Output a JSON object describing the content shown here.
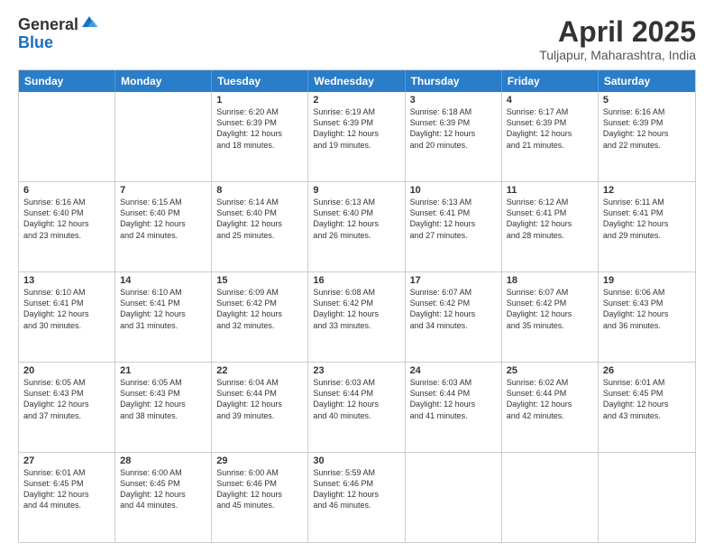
{
  "logo": {
    "general": "General",
    "blue": "Blue"
  },
  "header": {
    "title": "April 2025",
    "subtitle": "Tuljapur, Maharashtra, India"
  },
  "days": [
    "Sunday",
    "Monday",
    "Tuesday",
    "Wednesday",
    "Thursday",
    "Friday",
    "Saturday"
  ],
  "weeks": [
    [
      {
        "day": "",
        "lines": []
      },
      {
        "day": "",
        "lines": []
      },
      {
        "day": "1",
        "lines": [
          "Sunrise: 6:20 AM",
          "Sunset: 6:39 PM",
          "Daylight: 12 hours",
          "and 18 minutes."
        ]
      },
      {
        "day": "2",
        "lines": [
          "Sunrise: 6:19 AM",
          "Sunset: 6:39 PM",
          "Daylight: 12 hours",
          "and 19 minutes."
        ]
      },
      {
        "day": "3",
        "lines": [
          "Sunrise: 6:18 AM",
          "Sunset: 6:39 PM",
          "Daylight: 12 hours",
          "and 20 minutes."
        ]
      },
      {
        "day": "4",
        "lines": [
          "Sunrise: 6:17 AM",
          "Sunset: 6:39 PM",
          "Daylight: 12 hours",
          "and 21 minutes."
        ]
      },
      {
        "day": "5",
        "lines": [
          "Sunrise: 6:16 AM",
          "Sunset: 6:39 PM",
          "Daylight: 12 hours",
          "and 22 minutes."
        ]
      }
    ],
    [
      {
        "day": "6",
        "lines": [
          "Sunrise: 6:16 AM",
          "Sunset: 6:40 PM",
          "Daylight: 12 hours",
          "and 23 minutes."
        ]
      },
      {
        "day": "7",
        "lines": [
          "Sunrise: 6:15 AM",
          "Sunset: 6:40 PM",
          "Daylight: 12 hours",
          "and 24 minutes."
        ]
      },
      {
        "day": "8",
        "lines": [
          "Sunrise: 6:14 AM",
          "Sunset: 6:40 PM",
          "Daylight: 12 hours",
          "and 25 minutes."
        ]
      },
      {
        "day": "9",
        "lines": [
          "Sunrise: 6:13 AM",
          "Sunset: 6:40 PM",
          "Daylight: 12 hours",
          "and 26 minutes."
        ]
      },
      {
        "day": "10",
        "lines": [
          "Sunrise: 6:13 AM",
          "Sunset: 6:41 PM",
          "Daylight: 12 hours",
          "and 27 minutes."
        ]
      },
      {
        "day": "11",
        "lines": [
          "Sunrise: 6:12 AM",
          "Sunset: 6:41 PM",
          "Daylight: 12 hours",
          "and 28 minutes."
        ]
      },
      {
        "day": "12",
        "lines": [
          "Sunrise: 6:11 AM",
          "Sunset: 6:41 PM",
          "Daylight: 12 hours",
          "and 29 minutes."
        ]
      }
    ],
    [
      {
        "day": "13",
        "lines": [
          "Sunrise: 6:10 AM",
          "Sunset: 6:41 PM",
          "Daylight: 12 hours",
          "and 30 minutes."
        ]
      },
      {
        "day": "14",
        "lines": [
          "Sunrise: 6:10 AM",
          "Sunset: 6:41 PM",
          "Daylight: 12 hours",
          "and 31 minutes."
        ]
      },
      {
        "day": "15",
        "lines": [
          "Sunrise: 6:09 AM",
          "Sunset: 6:42 PM",
          "Daylight: 12 hours",
          "and 32 minutes."
        ]
      },
      {
        "day": "16",
        "lines": [
          "Sunrise: 6:08 AM",
          "Sunset: 6:42 PM",
          "Daylight: 12 hours",
          "and 33 minutes."
        ]
      },
      {
        "day": "17",
        "lines": [
          "Sunrise: 6:07 AM",
          "Sunset: 6:42 PM",
          "Daylight: 12 hours",
          "and 34 minutes."
        ]
      },
      {
        "day": "18",
        "lines": [
          "Sunrise: 6:07 AM",
          "Sunset: 6:42 PM",
          "Daylight: 12 hours",
          "and 35 minutes."
        ]
      },
      {
        "day": "19",
        "lines": [
          "Sunrise: 6:06 AM",
          "Sunset: 6:43 PM",
          "Daylight: 12 hours",
          "and 36 minutes."
        ]
      }
    ],
    [
      {
        "day": "20",
        "lines": [
          "Sunrise: 6:05 AM",
          "Sunset: 6:43 PM",
          "Daylight: 12 hours",
          "and 37 minutes."
        ]
      },
      {
        "day": "21",
        "lines": [
          "Sunrise: 6:05 AM",
          "Sunset: 6:43 PM",
          "Daylight: 12 hours",
          "and 38 minutes."
        ]
      },
      {
        "day": "22",
        "lines": [
          "Sunrise: 6:04 AM",
          "Sunset: 6:44 PM",
          "Daylight: 12 hours",
          "and 39 minutes."
        ]
      },
      {
        "day": "23",
        "lines": [
          "Sunrise: 6:03 AM",
          "Sunset: 6:44 PM",
          "Daylight: 12 hours",
          "and 40 minutes."
        ]
      },
      {
        "day": "24",
        "lines": [
          "Sunrise: 6:03 AM",
          "Sunset: 6:44 PM",
          "Daylight: 12 hours",
          "and 41 minutes."
        ]
      },
      {
        "day": "25",
        "lines": [
          "Sunrise: 6:02 AM",
          "Sunset: 6:44 PM",
          "Daylight: 12 hours",
          "and 42 minutes."
        ]
      },
      {
        "day": "26",
        "lines": [
          "Sunrise: 6:01 AM",
          "Sunset: 6:45 PM",
          "Daylight: 12 hours",
          "and 43 minutes."
        ]
      }
    ],
    [
      {
        "day": "27",
        "lines": [
          "Sunrise: 6:01 AM",
          "Sunset: 6:45 PM",
          "Daylight: 12 hours",
          "and 44 minutes."
        ]
      },
      {
        "day": "28",
        "lines": [
          "Sunrise: 6:00 AM",
          "Sunset: 6:45 PM",
          "Daylight: 12 hours",
          "and 44 minutes."
        ]
      },
      {
        "day": "29",
        "lines": [
          "Sunrise: 6:00 AM",
          "Sunset: 6:46 PM",
          "Daylight: 12 hours",
          "and 45 minutes."
        ]
      },
      {
        "day": "30",
        "lines": [
          "Sunrise: 5:59 AM",
          "Sunset: 6:46 PM",
          "Daylight: 12 hours",
          "and 46 minutes."
        ]
      },
      {
        "day": "",
        "lines": []
      },
      {
        "day": "",
        "lines": []
      },
      {
        "day": "",
        "lines": []
      }
    ]
  ]
}
